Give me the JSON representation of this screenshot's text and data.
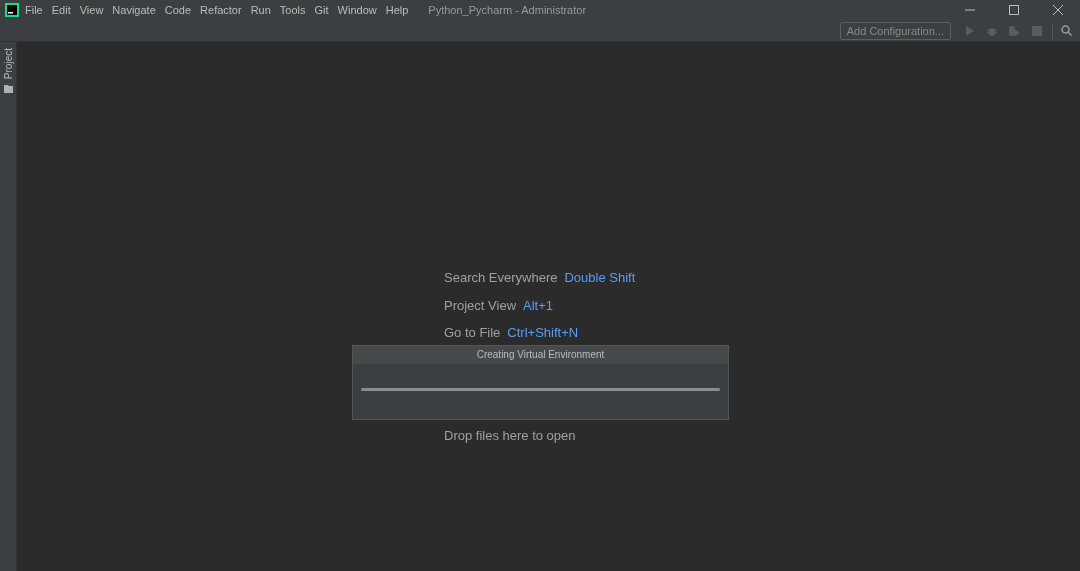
{
  "menu": [
    "File",
    "Edit",
    "View",
    "Navigate",
    "Code",
    "Refactor",
    "Run",
    "Tools",
    "Git",
    "Window",
    "Help"
  ],
  "window": {
    "title": "Python_Pycharm - Administrator"
  },
  "toolbar": {
    "config_button": "Add Configuration..."
  },
  "side_tabs": [
    {
      "label": "Project",
      "selected": false
    }
  ],
  "hints": [
    {
      "label": "Search Everywhere",
      "shortcut": "Double Shift"
    },
    {
      "label": "Project View",
      "shortcut": "Alt+1"
    },
    {
      "label": "Go to File",
      "shortcut": "Ctrl+Shift+N"
    },
    {
      "label": "Drop files here to open"
    }
  ],
  "dialog": {
    "title": "Creating Virtual Environment",
    "progress": {
      "level": 1
    }
  }
}
